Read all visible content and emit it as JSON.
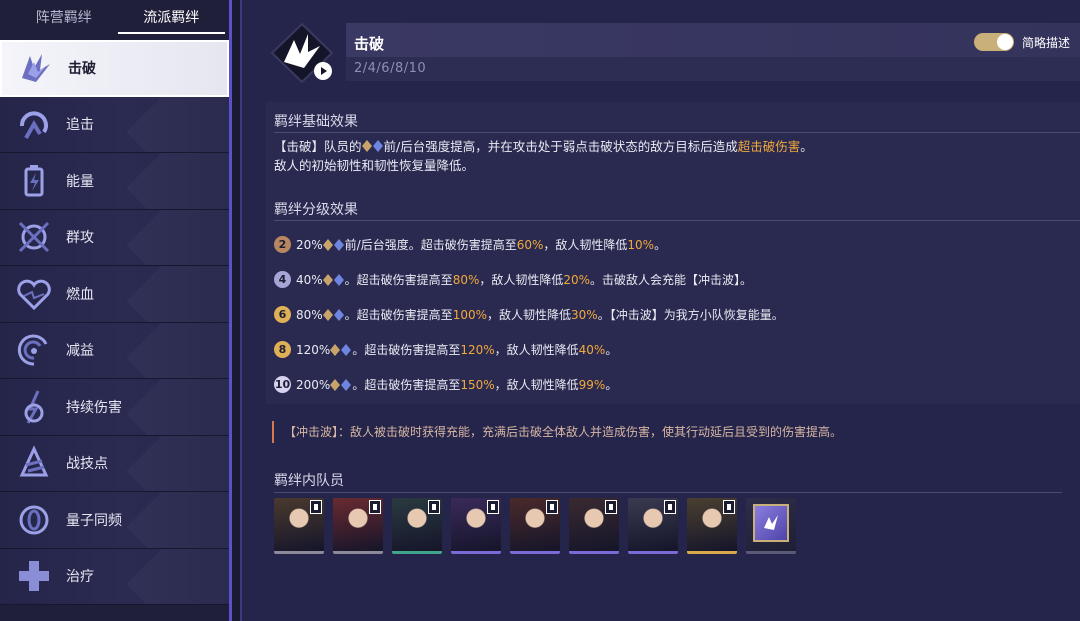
{
  "tabs": [
    {
      "label": "阵营羁绊",
      "active": false
    },
    {
      "label": "流派羁绊",
      "active": true
    }
  ],
  "sidebar": {
    "items": [
      {
        "label": "击破",
        "icon": "break-icon",
        "active": true
      },
      {
        "label": "追击",
        "icon": "follow-up-icon",
        "active": false
      },
      {
        "label": "能量",
        "icon": "energy-battery-icon",
        "active": false
      },
      {
        "label": "群攻",
        "icon": "aoe-icon",
        "active": false
      },
      {
        "label": "燃血",
        "icon": "burning-heart-icon",
        "active": false
      },
      {
        "label": "减益",
        "icon": "debuff-swirl-icon",
        "active": false
      },
      {
        "label": "持续伤害",
        "icon": "dot-damage-icon",
        "active": false
      },
      {
        "label": "战技点",
        "icon": "skill-point-icon",
        "active": false
      },
      {
        "label": "量子同频",
        "icon": "quantum-icon",
        "active": false
      },
      {
        "label": "治疗",
        "icon": "heal-cross-icon",
        "active": false
      }
    ]
  },
  "header": {
    "title": "击破",
    "levels": "2/4/6/8/10",
    "toggle_label": "简略描述",
    "toggle_on": true
  },
  "base_effect": {
    "title": "羁绊基础效果",
    "line1_a": "【击破】队员的",
    "line1_b": "前/后台强度提高，并在攻击处于弱点击破状态的敌方目标后造成",
    "line1_hl": "超击破伤害",
    "line1_c": "。",
    "line2": "敌人的初始韧性和韧性恢复量降低。"
  },
  "tier_effect": {
    "title": "羁绊分级效果",
    "tiers": [
      {
        "badge": "2",
        "badge_color": "#b88660",
        "pct": "20%",
        "icons": 2,
        "parts": [
          {
            "t": "前/后台强度。超击破伤害提高至"
          },
          {
            "t": "60%",
            "hl": true
          },
          {
            "t": "，敌人韧性降低"
          },
          {
            "t": "10%",
            "hl": true
          },
          {
            "t": "。"
          }
        ]
      },
      {
        "badge": "4",
        "badge_color": "#a7a5d6",
        "pct": "40%",
        "icons": 2,
        "parts": [
          {
            "t": "。超击破伤害提高至"
          },
          {
            "t": "80%",
            "hl": true
          },
          {
            "t": "，敌人韧性降低"
          },
          {
            "t": "20%",
            "hl": true
          },
          {
            "t": "。击破敌人会充能【冲击波】。"
          }
        ]
      },
      {
        "badge": "6",
        "badge_color": "#e0b056",
        "pct": "80%",
        "icons": 2,
        "parts": [
          {
            "t": "。超击破伤害提高至"
          },
          {
            "t": "100%",
            "hl": true
          },
          {
            "t": "，敌人韧性降低"
          },
          {
            "t": "30%",
            "hl": true
          },
          {
            "t": "。【冲击波】为我方小队恢复能量。"
          }
        ]
      },
      {
        "badge": "8",
        "badge_color": "#e0b056",
        "pct": "120%",
        "icons": 2,
        "parts": [
          {
            "t": "。超击破伤害提高至"
          },
          {
            "t": "120%",
            "hl": true
          },
          {
            "t": "，敌人韧性降低"
          },
          {
            "t": "40%",
            "hl": true
          },
          {
            "t": "。"
          }
        ]
      },
      {
        "badge": "10",
        "badge_color": "#d6d2f0",
        "pct": "200%",
        "icons": 2,
        "parts": [
          {
            "t": "。超击破伤害提高至"
          },
          {
            "t": "150%",
            "hl": true
          },
          {
            "t": "，敌人韧性降低"
          },
          {
            "t": "99%",
            "hl": true
          },
          {
            "t": "。"
          }
        ]
      }
    ]
  },
  "note": "【冲击波】：敌人被击破时获得充能，充满后击破全体敌人并造成伤害，使其行动延后且受到的伤害提高。",
  "members": {
    "title": "羁绊内队员",
    "list": [
      {
        "name": "member-1",
        "bg": "#4a3a2e",
        "strip": "#8a8a9a"
      },
      {
        "name": "member-2",
        "bg": "#6a2a30",
        "strip": "#8a8a9a"
      },
      {
        "name": "member-3",
        "bg": "#2a3a40",
        "strip": "#3fa48a"
      },
      {
        "name": "member-4",
        "bg": "#3a2a5a",
        "strip": "#7a6ad8"
      },
      {
        "name": "member-5",
        "bg": "#4a2a2a",
        "strip": "#7a6ad8"
      },
      {
        "name": "member-6",
        "bg": "#3a2a30",
        "strip": "#7a6ad8"
      },
      {
        "name": "member-7",
        "bg": "#3a3a50",
        "strip": "#7a6ad8"
      },
      {
        "name": "member-8",
        "bg": "#4a4030",
        "strip": "#d8a94a"
      },
      {
        "name": "item-card",
        "bg": "#2a2a44",
        "strip": "#5a5a78"
      }
    ]
  },
  "colors": {
    "accent": "#5b52c9",
    "highlight": "#f2a93b",
    "note_border": "#d47a4c"
  }
}
